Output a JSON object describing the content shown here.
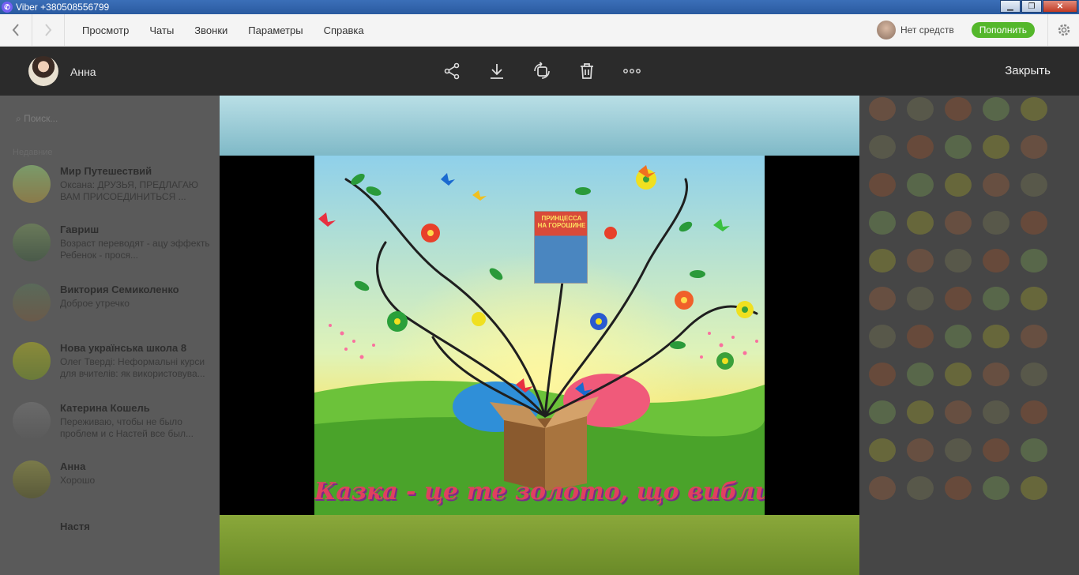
{
  "window": {
    "title": "Viber +380508556799",
    "app_icon": "viber-icon",
    "buttons": [
      "minimize",
      "maximize",
      "close"
    ]
  },
  "toolbar": {
    "menu": [
      "Просмотр",
      "Чаты",
      "Звонки",
      "Параметры",
      "Справка"
    ],
    "balance": "Нет средств",
    "topup": "Пополнить"
  },
  "chatlist": {
    "search_placeholder": "Поиск...",
    "section": "Недавние",
    "chats": [
      {
        "name": "Мир Путешествий",
        "preview1": "Оксана: ДРУЗЬЯ, ПРЕДЛАГАЮ",
        "preview2": "ВАМ ПРИСОЕДИНИТЬСЯ ..."
      },
      {
        "name": "Гавриш",
        "preview1": "Возраст переводят - ацу эффекты",
        "preview2": "Ребенок - прося..."
      },
      {
        "name": "Виктория Семиколенко",
        "preview1": "Доброе утречко",
        "preview2": ""
      },
      {
        "name": "Нова українська школа 8",
        "preview1": "Олег Тверді: Неформальні курси",
        "preview2": "для вчителів: як використовува..."
      },
      {
        "name": "Катерина Кошель",
        "preview1": "Переживаю, чтобы не было",
        "preview2": "проблем и с Настей все был..."
      },
      {
        "name": "Анна",
        "preview1": "Хорошо",
        "preview2": ""
      },
      {
        "name": "Настя",
        "preview1": "",
        "preview2": ""
      }
    ]
  },
  "viewer": {
    "user": "Анна",
    "tools": [
      "share-icon",
      "download-icon",
      "rotate-icon",
      "trash-icon",
      "more-icon"
    ],
    "close": "Закрыть",
    "image": {
      "caption": "Казка - це те золото, що виблиск",
      "book_title": "ПРИНЦЕССА НА ГОРОШИНЕ"
    }
  }
}
